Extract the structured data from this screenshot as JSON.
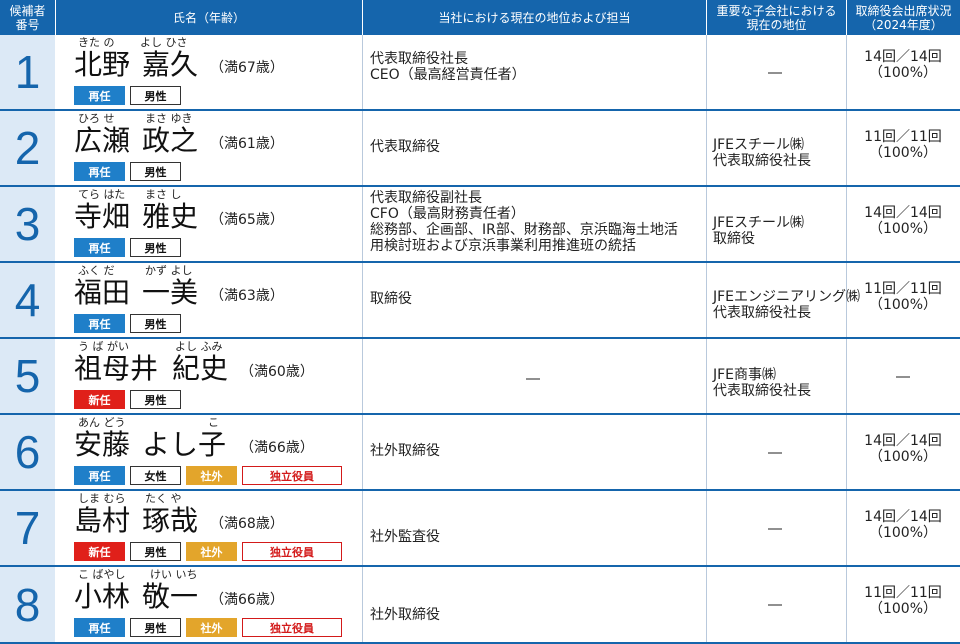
{
  "header": {
    "col_number": "候補者\n番号",
    "col_name": "氏名（年齢）",
    "col_position": "当社における現在の地位および担当",
    "col_subsidiary": "重要な子会社における\n現在の地位",
    "col_attendance": "取締役会出席状況\n（2024年度）"
  },
  "colors": {
    "header_bg": "#1565ac",
    "number_bg": "#dce9f6",
    "badge_reelect": "#1f7fc9",
    "badge_new": "#e0201a",
    "badge_outside": "#e3a52b",
    "badge_independent": "#d31a1a"
  },
  "candidates": [
    {
      "number": "1",
      "ruby_surname": "きた の",
      "ruby_given": "よし ひさ",
      "surname": "北野",
      "given": "嘉久",
      "age": "（満67歳）",
      "badges": [
        "再任",
        "男性"
      ],
      "position": "代表取締役社長\nCEO（最高経営責任者）",
      "subsidiary": "―",
      "attendance": "14回／14回\n（100%）"
    },
    {
      "number": "2",
      "ruby_surname": "ひろ せ",
      "ruby_given": "まさ ゆき",
      "surname": "広瀬",
      "given": "政之",
      "age": "（満61歳）",
      "badges": [
        "再任",
        "男性"
      ],
      "position": "代表取締役",
      "subsidiary": "JFEスチール㈱\n代表取締役社長",
      "attendance": "11回／11回\n（100%）"
    },
    {
      "number": "3",
      "ruby_surname": "てら はた",
      "ruby_given": "まさ し",
      "surname": "寺畑",
      "given": "雅史",
      "age": "（満65歳）",
      "badges": [
        "再任",
        "男性"
      ],
      "position": "代表取締役副社長\nCFO（最高財務責任者）\n総務部、企画部、IR部、財務部、京浜臨海土地活\n用検討班および京浜事業利用推進班の統括",
      "subsidiary": "JFEスチール㈱\n取締役",
      "attendance": "14回／14回\n（100%）"
    },
    {
      "number": "4",
      "ruby_surname": "ふく だ",
      "ruby_given": "かず よし",
      "surname": "福田",
      "given": "一美",
      "age": "（満63歳）",
      "badges": [
        "再任",
        "男性"
      ],
      "position": "取締役",
      "subsidiary": "JFEエンジニアリング㈱\n代表取締役社長",
      "attendance": "11回／11回\n（100%）"
    },
    {
      "number": "5",
      "ruby_surname": "う ば がい",
      "ruby_given": "よし ふみ",
      "surname": "祖母井",
      "given": "紀史",
      "age": "（満60歳）",
      "badges": [
        "新任",
        "男性"
      ],
      "position": "―",
      "subsidiary": "JFE商事㈱\n代表取締役社長",
      "attendance": "―"
    },
    {
      "number": "6",
      "ruby_surname": "あん どう",
      "ruby_given": "こ",
      "surname": "安藤",
      "given": "よし子",
      "age": "（満66歳）",
      "badges": [
        "再任",
        "女性",
        "社外",
        "独立役員"
      ],
      "position": "社外取締役",
      "subsidiary": "―",
      "attendance": "14回／14回\n（100%）"
    },
    {
      "number": "7",
      "ruby_surname": "しま むら",
      "ruby_given": "たく や",
      "surname": "島村",
      "given": "琢哉",
      "age": "（満68歳）",
      "badges": [
        "新任",
        "男性",
        "社外",
        "独立役員"
      ],
      "position": "社外監査役",
      "subsidiary": "―",
      "attendance": "14回／14回\n（100%）"
    },
    {
      "number": "8",
      "ruby_surname": "こ ばやし",
      "ruby_given": "けい いち",
      "surname": "小林",
      "given": "敬一",
      "age": "（満66歳）",
      "badges": [
        "再任",
        "男性",
        "社外",
        "独立役員"
      ],
      "position": "社外取締役",
      "subsidiary": "―",
      "attendance": "11回／11回\n（100%）"
    }
  ]
}
